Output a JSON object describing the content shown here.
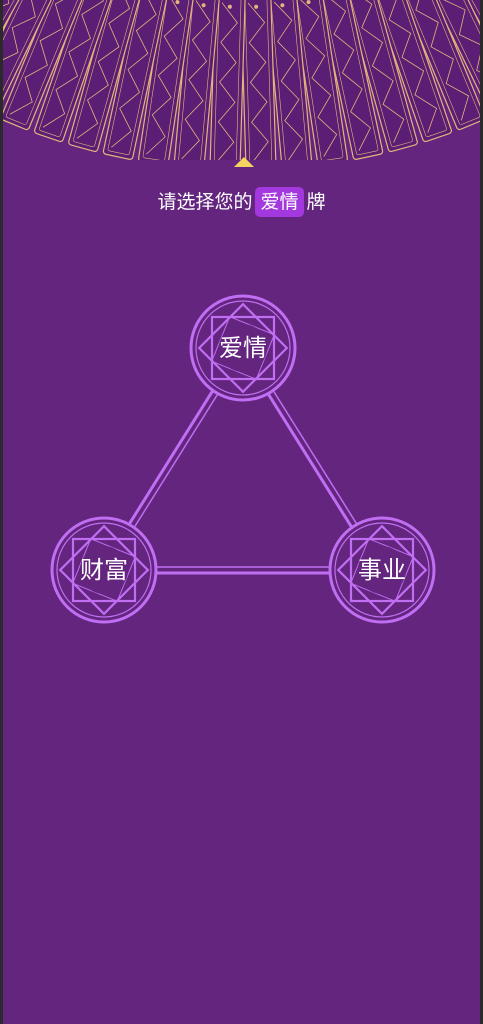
{
  "prompt": {
    "before": "请选择您的",
    "highlight": "爱情",
    "after": "牌"
  },
  "spread": {
    "nodes": [
      {
        "id": "love",
        "label": "爱情",
        "selected": true
      },
      {
        "id": "wealth",
        "label": "财富",
        "selected": false
      },
      {
        "id": "career",
        "label": "事业",
        "selected": false
      }
    ]
  },
  "colors": {
    "background": "#64257f",
    "card": "#5a1f75",
    "card_border": "#e6b37b",
    "pointer": "#f4d35e",
    "highlight": "#a438df",
    "spread_line": "#c06ef2"
  },
  "icons": {
    "pointer": "triangle-up-icon",
    "node_emblem": "star-emblem-icon"
  }
}
